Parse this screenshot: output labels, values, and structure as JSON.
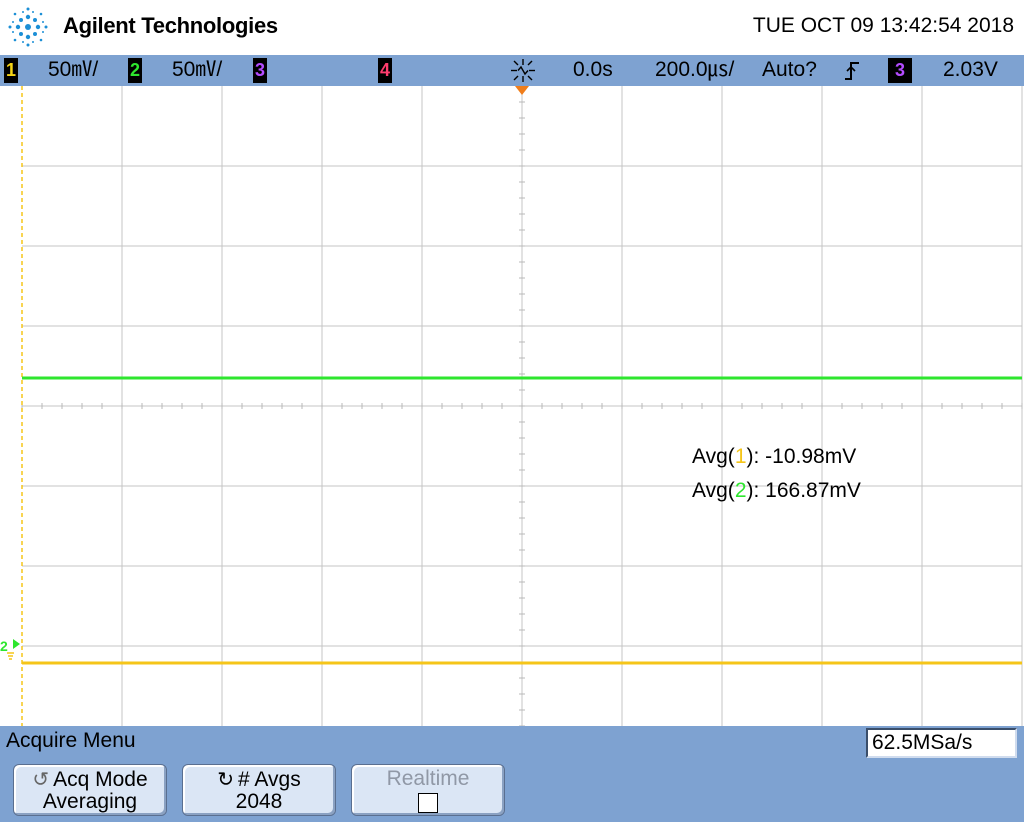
{
  "header": {
    "brand": "Agilent Technologies",
    "datetime": "TUE OCT 09 13:42:54 2018",
    "logo_icon": "agilent-spark-icon"
  },
  "statusbar": {
    "ch1": {
      "num": "1",
      "scale": "50㎷/",
      "color": "#f5d416"
    },
    "ch2": {
      "num": "2",
      "scale": "50㎷/",
      "color": "#2ee62e"
    },
    "ch3": {
      "num": "3",
      "color": "#b44cff"
    },
    "ch4": {
      "num": "4",
      "color": "#ff3d6e"
    },
    "run_icon": "trigger-run-icon",
    "delay": "0.0s",
    "timebase": "200.0㎲/",
    "trigger_mode": "Auto?",
    "trigger_slope_icon": "rising-edge-icon",
    "trigger_source": "3",
    "trigger_level": "2.03V"
  },
  "measurements": [
    {
      "prefix": "Avg(",
      "channel": "1",
      "suffix": "): ",
      "value": "-10.98mV",
      "color": "#f5c518"
    },
    {
      "prefix": "Avg(",
      "channel": "2",
      "suffix": "): ",
      "value": "166.87mV",
      "color": "#2ee62e"
    }
  ],
  "traces": {
    "ch1_color": "#f5c518",
    "ch2_color": "#2ee62e",
    "ground_marker_label": "2",
    "ground_marker_icon": "ground-marker-icon"
  },
  "softkeys": {
    "menu_title": "Acquire Menu",
    "sample_rate": "62.5MSa/s",
    "acq_mode_label": "Acq Mode",
    "acq_mode_value": "Averaging",
    "avgs_label": "# Avgs",
    "avgs_value": "2048",
    "realtime_label": "Realtime",
    "cycle_icon": "rotate-knob-icon"
  }
}
